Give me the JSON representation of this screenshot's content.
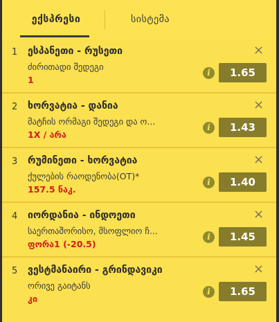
{
  "tabs": {
    "express_label": "ექსპრესი",
    "system_label": "სისტემა"
  },
  "bets": [
    {
      "number": "1",
      "teams": "ესპანეთი - რუსეთი",
      "market": "ძირითადი შედეგი",
      "pick": "1",
      "odds": "1.65"
    },
    {
      "number": "2",
      "teams": "ხორვატია - დანია",
      "market": "მატჩის ორმაგი შედეგი და ო...",
      "pick": "1X / არა",
      "odds": "1.43"
    },
    {
      "number": "3",
      "teams": "რუმინეთი - ხორვატია",
      "market": "ქულების რაოდენობა(OT)*",
      "pick": "157.5 ნაკ.",
      "odds": "1.40"
    },
    {
      "number": "4",
      "teams": "იორდანია - ინდოეთი",
      "market": "საერთაშორისო, მსოფლიო ჩ...",
      "pick": "ფორა1 (-20.5)",
      "odds": "1.45"
    },
    {
      "number": "5",
      "teams": "ვესტმანაირი - გრინდავიკი",
      "market": "ორივე გაიტანს",
      "pick": "კი",
      "odds": "1.65"
    }
  ],
  "icons": {
    "close": "×",
    "info": "i"
  },
  "colors": {
    "background": "#fbe050",
    "odds_bg": "#877c2b",
    "pick_red": "#d11c1c"
  }
}
